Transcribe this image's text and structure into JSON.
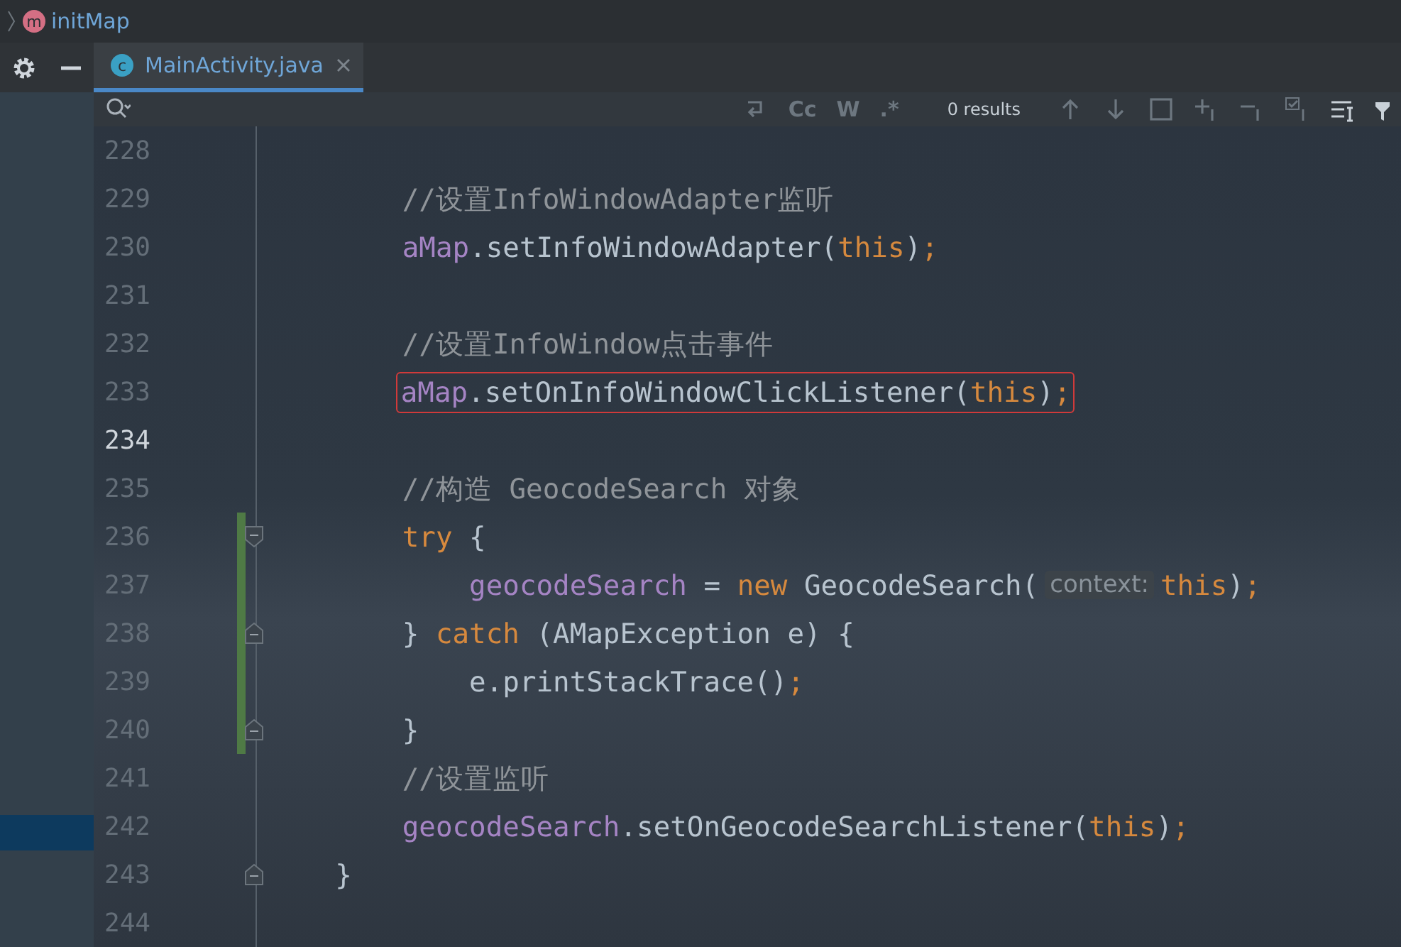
{
  "breadcrumb": {
    "badge": "m",
    "label": "initMap"
  },
  "tabs": [
    {
      "label": "MainActivity.java",
      "badge": "c",
      "selected": true
    }
  ],
  "search": {
    "toggles": [
      "Cc",
      "W",
      ".*"
    ],
    "results": "0 results"
  },
  "lines": [
    {
      "number": "228",
      "current": false,
      "boxed": false,
      "changed": false
    },
    {
      "number": "229",
      "current": false,
      "boxed": false,
      "changed": false,
      "tokens": [
        {
          "kind": "comment",
          "text": "        //设置InfoWindowAdapter监听"
        }
      ]
    },
    {
      "number": "230",
      "current": false,
      "boxed": false,
      "changed": false,
      "tokens": [
        {
          "kind": "field",
          "text": "        aMap"
        },
        {
          "kind": "plain",
          "text": ".setInfoWindowAdapter("
        },
        {
          "kind": "keyword",
          "text": "this"
        },
        {
          "kind": "plain",
          "text": ")"
        },
        {
          "kind": "keyword",
          "text": ";"
        }
      ]
    },
    {
      "number": "231",
      "current": false,
      "boxed": false,
      "changed": false
    },
    {
      "number": "232",
      "current": false,
      "boxed": false,
      "changed": false,
      "tokens": [
        {
          "kind": "comment",
          "text": "        //设置InfoWindow点击事件"
        }
      ]
    },
    {
      "number": "233",
      "current": false,
      "boxed": true,
      "changed": false,
      "tokens": [
        {
          "kind": "field",
          "text": "aMap"
        },
        {
          "kind": "plain",
          "text": ".setOnInfoWindowClickListener("
        },
        {
          "kind": "keyword",
          "text": "this"
        },
        {
          "kind": "plain",
          "text": ")"
        },
        {
          "kind": "keyword",
          "text": ";"
        }
      ]
    },
    {
      "number": "234",
      "current": true,
      "boxed": false,
      "changed": false
    },
    {
      "number": "235",
      "current": false,
      "boxed": false,
      "changed": false,
      "tokens": [
        {
          "kind": "comment",
          "text": "        //构造 GeocodeSearch 对象"
        }
      ]
    },
    {
      "number": "236",
      "current": false,
      "boxed": false,
      "fold_open": true,
      "changed": true,
      "tokens": [
        {
          "kind": "keyword",
          "text": "        try"
        },
        {
          "kind": "plain",
          "text": " {"
        }
      ]
    },
    {
      "number": "237",
      "current": false,
      "boxed": false,
      "changed": true,
      "tokens": [
        {
          "kind": "field",
          "text": "            geocodeSearch"
        },
        {
          "kind": "plain",
          "text": " = "
        },
        {
          "kind": "keyword",
          "text": "new"
        },
        {
          "kind": "plain",
          "text": " GeocodeSearch("
        },
        {
          "kind": "hint",
          "text": "context:"
        },
        {
          "kind": "keyword",
          "text": "this"
        },
        {
          "kind": "plain",
          "text": ")"
        },
        {
          "kind": "keyword",
          "text": ";"
        }
      ]
    },
    {
      "number": "238",
      "current": false,
      "boxed": false,
      "fold_close": true,
      "changed": true,
      "tokens": [
        {
          "kind": "plain",
          "text": "        } "
        },
        {
          "kind": "keyword",
          "text": "catch"
        },
        {
          "kind": "plain",
          "text": " (AMapException e) {"
        }
      ]
    },
    {
      "number": "239",
      "current": false,
      "boxed": false,
      "changed": true,
      "tokens": [
        {
          "kind": "plain",
          "text": "            e.printStackTrace()"
        },
        {
          "kind": "keyword",
          "text": ";"
        }
      ]
    },
    {
      "number": "240",
      "current": false,
      "boxed": false,
      "fold_close": true,
      "changed": true,
      "tokens": [
        {
          "kind": "plain",
          "text": "        }"
        }
      ]
    },
    {
      "number": "241",
      "current": false,
      "boxed": false,
      "changed": false,
      "tokens": [
        {
          "kind": "comment",
          "text": "        //设置监听"
        }
      ]
    },
    {
      "number": "242",
      "current": false,
      "boxed": false,
      "changed": false,
      "tokens": [
        {
          "kind": "field",
          "text": "        geocodeSearch"
        },
        {
          "kind": "plain",
          "text": ".setOnGeocodeSearchListener("
        },
        {
          "kind": "keyword",
          "text": "this"
        },
        {
          "kind": "plain",
          "text": ")"
        },
        {
          "kind": "keyword",
          "text": ";"
        }
      ]
    },
    {
      "number": "243",
      "current": false,
      "boxed": false,
      "fold_close": true,
      "changed": false,
      "tokens": [
        {
          "kind": "plain",
          "text": "    }"
        }
      ]
    },
    {
      "number": "244",
      "current": false,
      "boxed": false,
      "changed": false
    }
  ]
}
